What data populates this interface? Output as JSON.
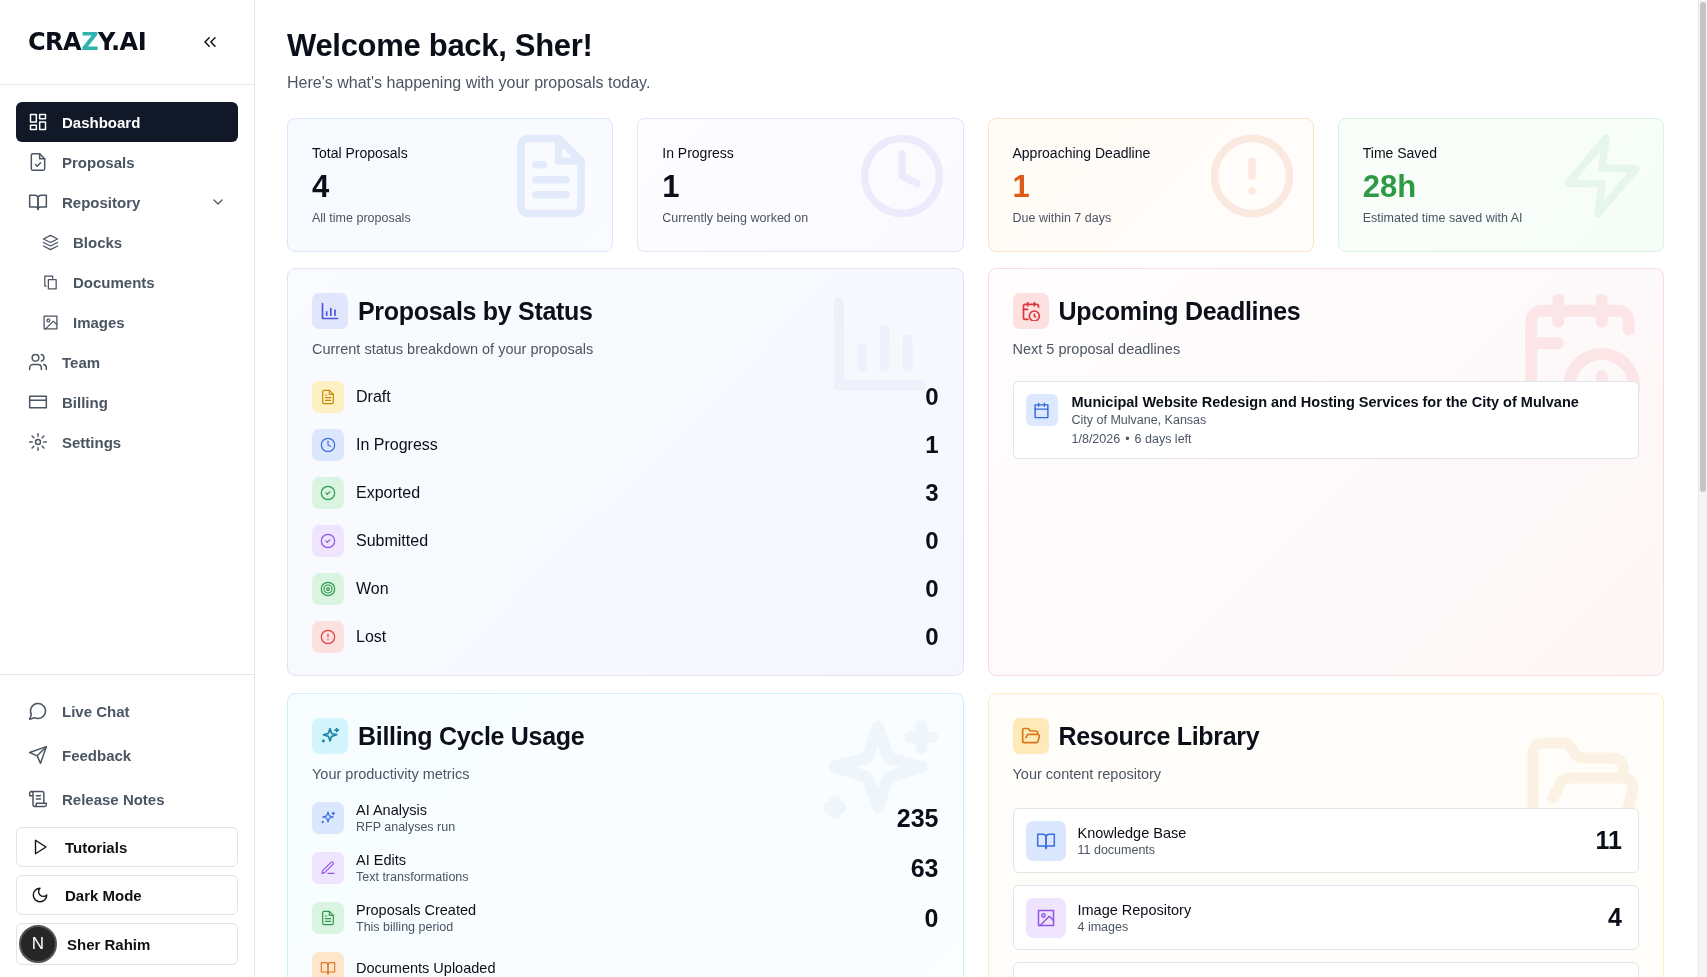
{
  "sidebar": {
    "logo": "CRAZY.AI",
    "nav": [
      {
        "label": "Dashboard",
        "selected": true
      },
      {
        "label": "Proposals",
        "selected": false
      },
      {
        "label": "Repository",
        "selected": false,
        "expanded": true,
        "children": [
          {
            "label": "Blocks",
            "selected": false
          },
          {
            "label": "Documents",
            "selected": false
          },
          {
            "label": "Images",
            "selected": false
          }
        ]
      },
      {
        "label": "Team",
        "selected": false
      },
      {
        "label": "Billing",
        "selected": false
      },
      {
        "label": "Settings",
        "selected": false
      }
    ],
    "links": [
      "Live Chat",
      "Feedback",
      "Release Notes"
    ],
    "buttons": [
      "Tutorials",
      "Dark Mode"
    ],
    "user": {
      "initial": "N",
      "name": "Sher Rahim"
    }
  },
  "header": {
    "title": "Welcome back, Sher!",
    "subtitle": "Here's what's happening with your proposals today."
  },
  "stats": [
    {
      "kind": "info",
      "label": "Total Proposals",
      "value": "4",
      "note": "All time proposals"
    },
    {
      "kind": "accent",
      "label": "In Progress",
      "value": "1",
      "note": "Currently being worked on"
    },
    {
      "kind": "warning",
      "label": "Approaching Deadline",
      "value": "1",
      "note": "Due within 7 days"
    },
    {
      "kind": "success",
      "label": "Time Saved",
      "value": "28h",
      "note": "Estimated time saved with AI"
    }
  ],
  "status_panel": {
    "title": "Proposals by Status",
    "subtitle": "Current status breakdown of your proposals",
    "rows": [
      {
        "kind": "draft",
        "label": "Draft",
        "value": "0"
      },
      {
        "kind": "progress",
        "label": "In Progress",
        "value": "1"
      },
      {
        "kind": "exported",
        "label": "Exported",
        "value": "3"
      },
      {
        "kind": "submitted",
        "label": "Submitted",
        "value": "0"
      },
      {
        "kind": "won",
        "label": "Won",
        "value": "0"
      },
      {
        "kind": "lost",
        "label": "Lost",
        "value": "0"
      }
    ]
  },
  "deadlines_panel": {
    "title": "Upcoming Deadlines",
    "subtitle": "Next 5 proposal deadlines",
    "items": [
      {
        "title": "Municipal Website Redesign and Hosting Services for the City of Mulvane",
        "client": "City of Mulvane, Kansas",
        "date": "1/8/2026",
        "separator": "•",
        "remaining": "6 days left"
      }
    ]
  },
  "usage_panel": {
    "title": "Billing Cycle Usage",
    "subtitle": "Your productivity metrics",
    "rows": [
      {
        "kind": "analysis",
        "label": "AI Analysis",
        "note": "RFP analyses run",
        "value": "235"
      },
      {
        "kind": "edits",
        "label": "AI Edits",
        "note": "Text transformations",
        "value": "63"
      },
      {
        "kind": "created",
        "label": "Proposals Created",
        "note": "This billing period",
        "value": "0"
      },
      {
        "kind": "uploaded",
        "label": "Documents Uploaded"
      }
    ]
  },
  "resources_panel": {
    "title": "Resource Library",
    "subtitle": "Your content repository",
    "items": [
      {
        "kind": "knowledge",
        "label": "Knowledge Base",
        "note": "11 documents",
        "value": "11"
      },
      {
        "kind": "images",
        "label": "Image Repository",
        "note": "4 images",
        "value": "4"
      }
    ]
  }
}
